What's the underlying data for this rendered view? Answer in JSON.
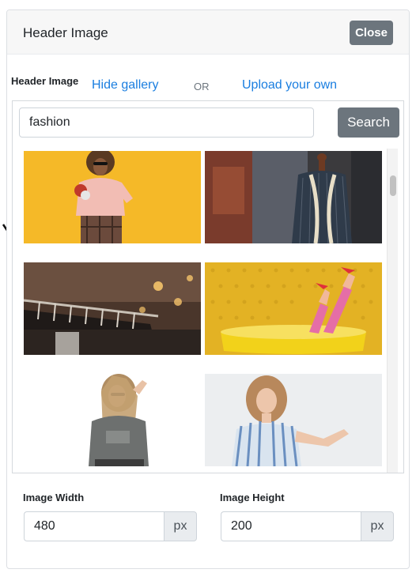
{
  "modal": {
    "title": "Header Image",
    "close_label": "Close"
  },
  "gallery": {
    "label": "Header Image",
    "hide_link": "Hide gallery",
    "or_text": "OR",
    "upload_link": "Upload your own",
    "search": {
      "value": "fashion",
      "button_label": "Search"
    },
    "images": [
      {
        "subject": "woman-sunglasses-yellow-background"
      },
      {
        "subject": "tailor-mannequin-measuring-tape"
      },
      {
        "subject": "clothing-rack-store"
      },
      {
        "subject": "legs-pink-heels-yellow-bathtub"
      },
      {
        "subject": "woman-gray-tshirt-white-background"
      },
      {
        "subject": "woman-striped-shirt-white-background"
      }
    ]
  },
  "dimensions": {
    "width_label": "Image Width",
    "width_value": "480",
    "width_unit": "px",
    "height_label": "Image Height",
    "height_value": "200",
    "height_unit": "px"
  },
  "colors": {
    "link": "#1a7ee0",
    "secondary_button": "#6c757d"
  }
}
